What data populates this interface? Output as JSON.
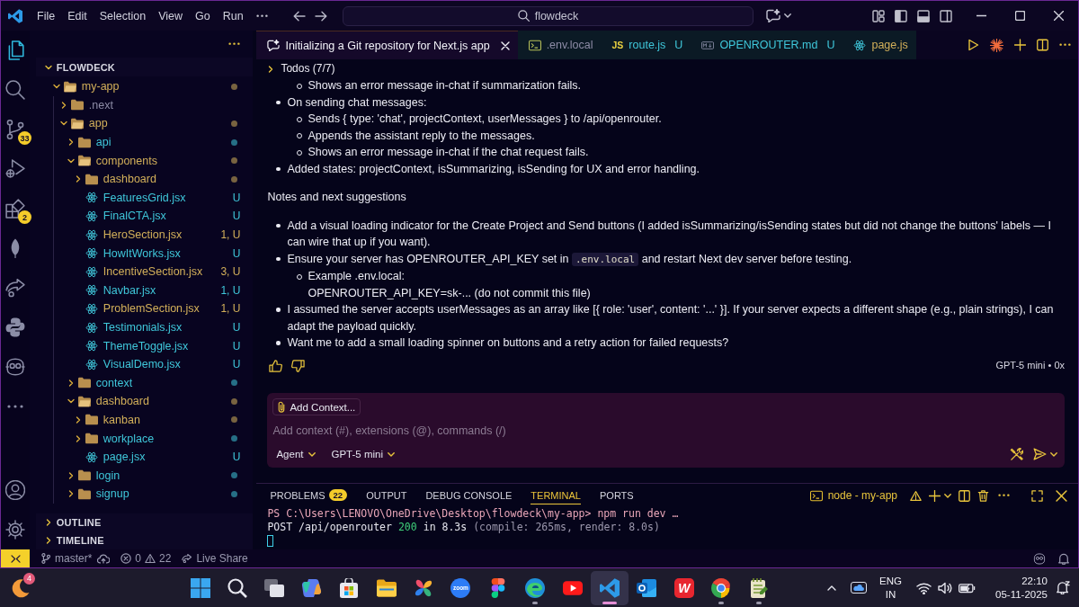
{
  "title_bar": {
    "menus": [
      "File",
      "Edit",
      "Selection",
      "View",
      "Go",
      "Run"
    ],
    "command_center": "flowdeck"
  },
  "activity_bar": [
    {
      "kind": "files",
      "selected": true
    },
    {
      "kind": "search",
      "selected": false
    },
    {
      "kind": "git",
      "selected": false,
      "badge": "33"
    },
    {
      "kind": "debug",
      "selected": false
    },
    {
      "kind": "extensions",
      "selected": false,
      "badge": "2"
    },
    {
      "kind": "leaf",
      "selected": false
    },
    {
      "kind": "share",
      "selected": false
    },
    {
      "kind": "python",
      "selected": false
    },
    {
      "kind": "copilot",
      "selected": false
    },
    {
      "kind": "more",
      "selected": false
    }
  ],
  "activity_bar_bottom": [
    {
      "kind": "account"
    },
    {
      "kind": "gear"
    }
  ],
  "sidebar": {
    "section": {
      "label": "FLOWDECK",
      "expanded": true
    },
    "tree": [
      {
        "name": "my-app",
        "kind": "folder",
        "expanded": true,
        "color": "#d3b05a",
        "dot": true,
        "children": [
          {
            "name": ".next",
            "kind": "folder",
            "expanded": false,
            "color": "#8d8ca6",
            "dot": false
          },
          {
            "name": "app",
            "kind": "folder",
            "expanded": true,
            "color": "#d3b05a",
            "dot": true,
            "children": [
              {
                "name": "api",
                "kind": "folder",
                "expanded": false,
                "color": "#3fc7da",
                "dot": true
              },
              {
                "name": "components",
                "kind": "folder",
                "expanded": true,
                "color": "#d3b05a",
                "dot": true,
                "children": [
                  {
                    "name": "dashboard",
                    "kind": "folder",
                    "expanded": false,
                    "color": "#d3b05a",
                    "dot": true
                  },
                  {
                    "name": "FeaturesGrid.jsx",
                    "kind": "file",
                    "color": "#3fc7da",
                    "dot": false,
                    "badge": "U"
                  },
                  {
                    "name": "FinalCTA.jsx",
                    "kind": "file",
                    "color": "#3fc7da",
                    "dot": false,
                    "badge": "U"
                  },
                  {
                    "name": "HeroSection.jsx",
                    "kind": "file",
                    "color": "#d3b05a",
                    "dot": false,
                    "badge": "1, U"
                  },
                  {
                    "name": "HowItWorks.jsx",
                    "kind": "file",
                    "color": "#3fc7da",
                    "dot": false,
                    "badge": "U"
                  },
                  {
                    "name": "IncentiveSection.jsx",
                    "kind": "file",
                    "color": "#d3b05a",
                    "dot": false,
                    "badge": "3, U"
                  },
                  {
                    "name": "Navbar.jsx",
                    "kind": "file",
                    "color": "#3fc7da",
                    "dot": false,
                    "badge": "1, U"
                  },
                  {
                    "name": "ProblemSection.jsx",
                    "kind": "file",
                    "color": "#d3b05a",
                    "dot": false,
                    "badge": "1, U"
                  },
                  {
                    "name": "Testimonials.jsx",
                    "kind": "file",
                    "color": "#3fc7da",
                    "dot": false,
                    "badge": "U"
                  },
                  {
                    "name": "ThemeToggle.jsx",
                    "kind": "file",
                    "color": "#3fc7da",
                    "dot": false,
                    "badge": "U"
                  },
                  {
                    "name": "VisualDemo.jsx",
                    "kind": "file",
                    "color": "#3fc7da",
                    "dot": false,
                    "badge": "U"
                  }
                ]
              },
              {
                "name": "context",
                "kind": "folder",
                "expanded": false,
                "color": "#3fc7da",
                "dot": true
              },
              {
                "name": "dashboard",
                "kind": "folder",
                "expanded": true,
                "color": "#d3b05a",
                "dot": true,
                "children": [
                  {
                    "name": "kanban",
                    "kind": "folder",
                    "expanded": false,
                    "color": "#d3b05a",
                    "dot": true
                  },
                  {
                    "name": "workplace",
                    "kind": "folder",
                    "expanded": false,
                    "color": "#3fc7da",
                    "dot": true
                  },
                  {
                    "name": "page.jsx",
                    "kind": "file",
                    "color": "#3fc7da",
                    "dot": false,
                    "badge": "U"
                  }
                ]
              },
              {
                "name": "login",
                "kind": "folder",
                "expanded": false,
                "color": "#3fc7da",
                "dot": true
              },
              {
                "name": "signup",
                "kind": "folder",
                "expanded": false,
                "color": "#3fc7da",
                "dot": true
              }
            ]
          }
        ]
      }
    ],
    "panels": [
      {
        "label": "OUTLINE",
        "expanded": false
      },
      {
        "label": "TIMELINE",
        "expanded": false
      }
    ]
  },
  "editor_tabs": [
    {
      "kind": "chat",
      "label": "Initializing a Git repository for Next.js app",
      "selected": true,
      "color": "#f2f2f8"
    },
    {
      "kind": "terminal",
      "label": ".env.local",
      "selected": false,
      "color": "#8d8ca6"
    },
    {
      "kind": "js",
      "tag": "JS",
      "label": "route.js",
      "badge": "U",
      "selected": false,
      "color": "#3fc7da"
    },
    {
      "kind": "markdown",
      "label": "OPENROUTER.md",
      "badge": "U",
      "selected": false,
      "color": "#3fc7da"
    },
    {
      "kind": "react",
      "label": "page.js",
      "selected": false,
      "color": "#d3b05a"
    }
  ],
  "chat": {
    "todos": {
      "label": "Todos (7/7)",
      "expanded": false
    },
    "blocks": [
      {
        "kind": "list",
        "items": [
          {
            "children": [
              {
                "text": "Shows an error message in-chat if summarization fails."
              }
            ]
          },
          {
            "text": "On sending chat messages:",
            "children": [
              {
                "text": "Sends { type: 'chat', projectContext, userMessages } to /api/openrouter."
              },
              {
                "text": "Appends the assistant reply to the messages."
              },
              {
                "text": "Shows an error message in-chat if the chat request fails."
              }
            ]
          },
          {
            "text": "Added states: projectContext, isSummarizing, isSending for UX and error handling."
          }
        ]
      },
      {
        "kind": "paragraph",
        "text": "Notes and next suggestions"
      },
      {
        "kind": "list",
        "items": [
          {
            "text": "Add a visual loading indicator for the Create Project and Send buttons (I added isSummarizing/isSending states but did not change the buttons' labels — I can wire that up if you want)."
          },
          {
            "parts": [
              {
                "kind": "text",
                "text": "Ensure your server has OPENROUTER_API_KEY set in "
              },
              {
                "kind": "code",
                "text": ".env.local"
              },
              {
                "kind": "text",
                "text": " and restart Next dev server before testing."
              }
            ],
            "children": [
              {
                "lines": [
                  "Example .env.local:",
                  "OPENROUTER_API_KEY=sk-... (do not commit this file)"
                ]
              }
            ]
          },
          {
            "text": "I assumed the server accepts userMessages as an array like [{ role: 'user', content: '...' }]. If your server expects a different shape (e.g., plain strings), I can adapt the payload quickly."
          },
          {
            "text": "Want me to add a small loading spinner on buttons and a retry action for failed requests?"
          }
        ]
      }
    ],
    "model_info": "GPT-5 mini • 0x"
  },
  "chat_input": {
    "context_button": "Add Context...",
    "placeholder": "Add context (#), extensions (@), commands (/)",
    "mode": "Agent",
    "model": "GPT-5 mini"
  },
  "panel": {
    "tabs": [
      {
        "label": "PROBLEMS",
        "badge": "22",
        "selected": false
      },
      {
        "label": "OUTPUT",
        "selected": false
      },
      {
        "label": "DEBUG CONSOLE",
        "selected": false
      },
      {
        "label": "TERMINAL",
        "selected": true
      },
      {
        "label": "PORTS",
        "selected": false
      }
    ],
    "terminal_name": "node - my-app",
    "lines": [
      {
        "segments": [
          {
            "kind": "prompt",
            "text": "PS C:\\Users\\LENOVO\\OneDrive\\Desktop\\flowdeck\\my-app> npm run dev …"
          }
        ]
      },
      {
        "segments": [
          {
            "kind": "plain",
            "text": "POST /api/openrouter"
          },
          {
            "kind": "success",
            "text": "200"
          },
          {
            "kind": "plain",
            "text": "in 8.3s"
          },
          {
            "kind": "dim",
            "text": "(compile: 265ms, render: 8.0s)"
          }
        ]
      }
    ]
  },
  "status_bar": {
    "branch": "master*",
    "errors": "0",
    "warnings": "22",
    "live_share": "Live Share"
  },
  "taskbar": {
    "widget_badge": "4",
    "apps": [
      {
        "kind": "start",
        "selected": false,
        "running": false
      },
      {
        "kind": "search",
        "selected": false,
        "running": false
      },
      {
        "kind": "taskview",
        "selected": false,
        "running": false
      },
      {
        "kind": "copilot",
        "selected": false,
        "running": false
      },
      {
        "kind": "store",
        "selected": false,
        "running": false
      },
      {
        "kind": "files",
        "selected": false,
        "running": false
      },
      {
        "kind": "photos",
        "selected": false,
        "running": false
      },
      {
        "kind": "zoom",
        "label": "zoom",
        "selected": false,
        "running": false
      },
      {
        "kind": "figma",
        "selected": false,
        "running": false
      },
      {
        "kind": "edge",
        "selected": false,
        "running": true
      },
      {
        "kind": "youtube",
        "selected": false,
        "running": false
      },
      {
        "kind": "vscode",
        "selected": true,
        "running": true
      },
      {
        "kind": "outlook",
        "selected": false,
        "running": false
      },
      {
        "kind": "wps",
        "label": "W",
        "selected": false,
        "running": false
      },
      {
        "kind": "chrome",
        "selected": false,
        "running": true
      },
      {
        "kind": "notepad",
        "selected": false,
        "running": true
      }
    ],
    "tray": {
      "language": "ENG",
      "region": "IN",
      "time": "22:10",
      "date": "05-11-2025"
    }
  }
}
